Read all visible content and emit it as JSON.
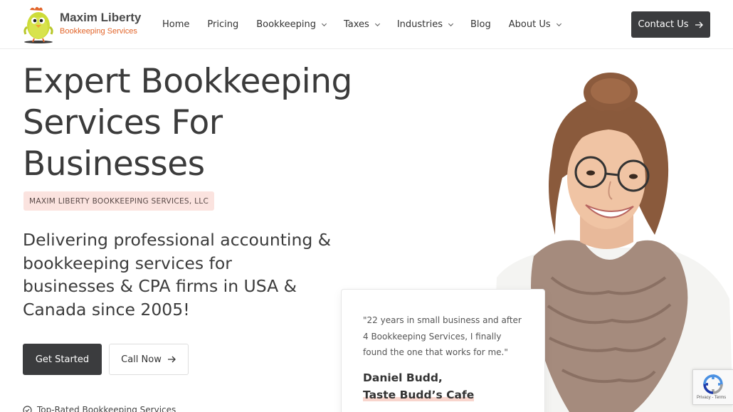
{
  "brand": {
    "name": "Maxim Liberty",
    "tagline": "Bookkeeping Services",
    "accent_color": "#e2652a",
    "dark_button_color": "#3b3c3e",
    "badge_color": "#fbe3df"
  },
  "nav": {
    "items": [
      {
        "label": "Home",
        "has_dropdown": false
      },
      {
        "label": "Pricing",
        "has_dropdown": false
      },
      {
        "label": "Bookkeeping",
        "has_dropdown": true
      },
      {
        "label": "Taxes",
        "has_dropdown": true
      },
      {
        "label": "Industries",
        "has_dropdown": true
      },
      {
        "label": "Blog",
        "has_dropdown": false
      },
      {
        "label": "About Us",
        "has_dropdown": true
      }
    ],
    "contact_label": "Contact Us",
    "contact_icon": "arrow-right-icon"
  },
  "hero": {
    "title_lines": [
      "Expert Bookkeeping",
      "Services For",
      "Businesses"
    ],
    "badge": "MAXIM LIBERTY BOOKKEEPING SERVICES, LLC",
    "subtitle_lines": [
      "Delivering professional accounting &",
      "bookkeeping services for",
      "businesses & CPA firms in USA &",
      "Canada since 2005!"
    ],
    "primary_button": "Get Started",
    "secondary_button": "Call Now",
    "feature": "Top-Rated Bookkeeping Services"
  },
  "testimonial": {
    "quote_lines": [
      "\"22 years in small business and after",
      "4 Bookkeeping Services, I finally",
      "found the one that works for me.\""
    ],
    "author_name": "Daniel Budd,",
    "author_company": "Taste Budd’s Cafe"
  },
  "recaptcha": {
    "text": "Privacy - Terms"
  }
}
